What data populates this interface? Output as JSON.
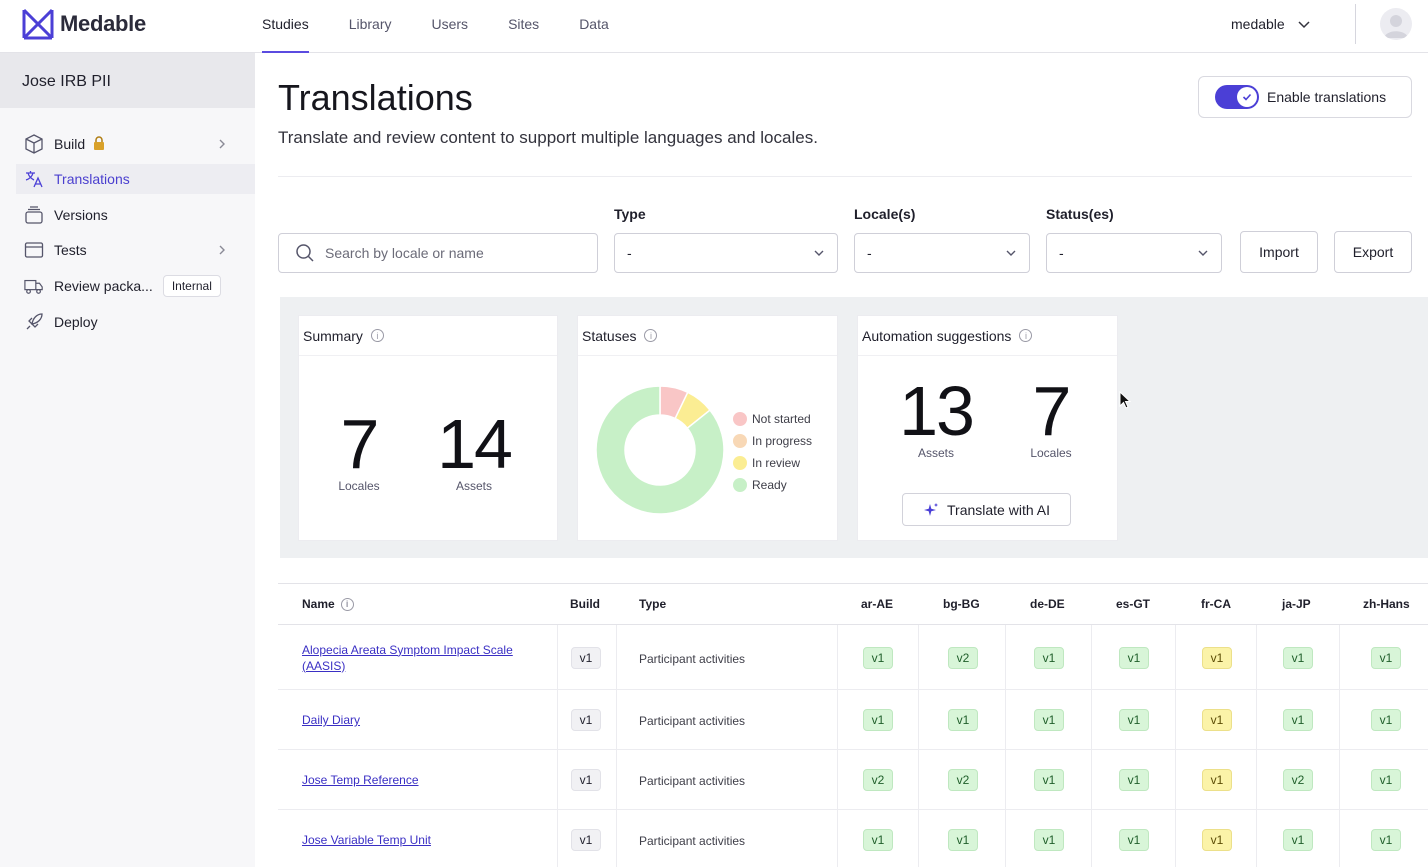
{
  "app": {
    "brand": "Medable",
    "nav": [
      "Studies",
      "Library",
      "Users",
      "Sites",
      "Data"
    ],
    "org": "medable"
  },
  "sidebar": {
    "study": "Jose IRB PII",
    "items": [
      {
        "label": "Build",
        "icon": "cube-icon"
      },
      {
        "label": "Translations",
        "icon": "translate-icon"
      },
      {
        "label": "Versions",
        "icon": "versions-icon"
      },
      {
        "label": "Tests",
        "icon": "browser-icon"
      },
      {
        "label": "Review packa...",
        "icon": "truck-icon",
        "badge": "Internal"
      },
      {
        "label": "Deploy",
        "icon": "rocket-icon"
      }
    ]
  },
  "page": {
    "title": "Translations",
    "subtitle": "Translate and review content to support multiple languages and locales.",
    "enable_label": "Enable translations"
  },
  "filters": {
    "search_placeholder": "Search by locale or name",
    "type_label": "Type",
    "type_value": "-",
    "locale_label": "Locale(s)",
    "locale_value": "-",
    "status_label": "Status(es)",
    "status_value": "-",
    "import_label": "Import",
    "export_label": "Export"
  },
  "summary": {
    "title": "Summary",
    "locales_value": "7",
    "locales_label": "Locales",
    "assets_value": "14",
    "assets_label": "Assets"
  },
  "statuses": {
    "title": "Statuses",
    "legend": [
      {
        "label": "Not started",
        "color": "#f9c6c6",
        "value": 1
      },
      {
        "label": "In progress",
        "color": "#f8d8b6",
        "value": 0
      },
      {
        "label": "In review",
        "color": "#fbed93",
        "value": 1
      },
      {
        "label": "Ready",
        "color": "#c7f0c7",
        "value": 12
      }
    ]
  },
  "automation": {
    "title": "Automation suggestions",
    "assets_value": "13",
    "assets_label": "Assets",
    "locales_value": "7",
    "locales_label": "Locales",
    "button": "Translate with AI"
  },
  "table": {
    "headers": {
      "name": "Name",
      "build": "Build",
      "type": "Type"
    },
    "locales": [
      "ar-AE",
      "bg-BG",
      "de-DE",
      "es-GT",
      "fr-CA",
      "ja-JP",
      "zh-Hans"
    ],
    "rows": [
      {
        "name": "Alopecia Areata Symptom Impact Scale (AASIS)",
        "build": "v1",
        "type": "Participant activities",
        "versions": [
          "v1",
          "v2",
          "v1",
          "v1",
          "v1",
          "v1",
          "v1"
        ]
      },
      {
        "name": "Daily Diary",
        "build": "v1",
        "type": "Participant activities",
        "versions": [
          "v1",
          "v1",
          "v1",
          "v1",
          "v1",
          "v1",
          "v1"
        ]
      },
      {
        "name": "Jose Temp Reference",
        "build": "v1",
        "type": "Participant activities",
        "versions": [
          "v2",
          "v2",
          "v1",
          "v1",
          "v1",
          "v2",
          "v1"
        ]
      },
      {
        "name": "Jose Variable Temp Unit",
        "build": "v1",
        "type": "Participant activities",
        "versions": [
          "v1",
          "v1",
          "v1",
          "v1",
          "v1",
          "v1",
          "v1"
        ]
      }
    ]
  },
  "colors": {
    "accent": "#4b3fd6",
    "link": "#3a2fc4",
    "ready": "#d8f5d8",
    "review": "#fbf3a8"
  }
}
